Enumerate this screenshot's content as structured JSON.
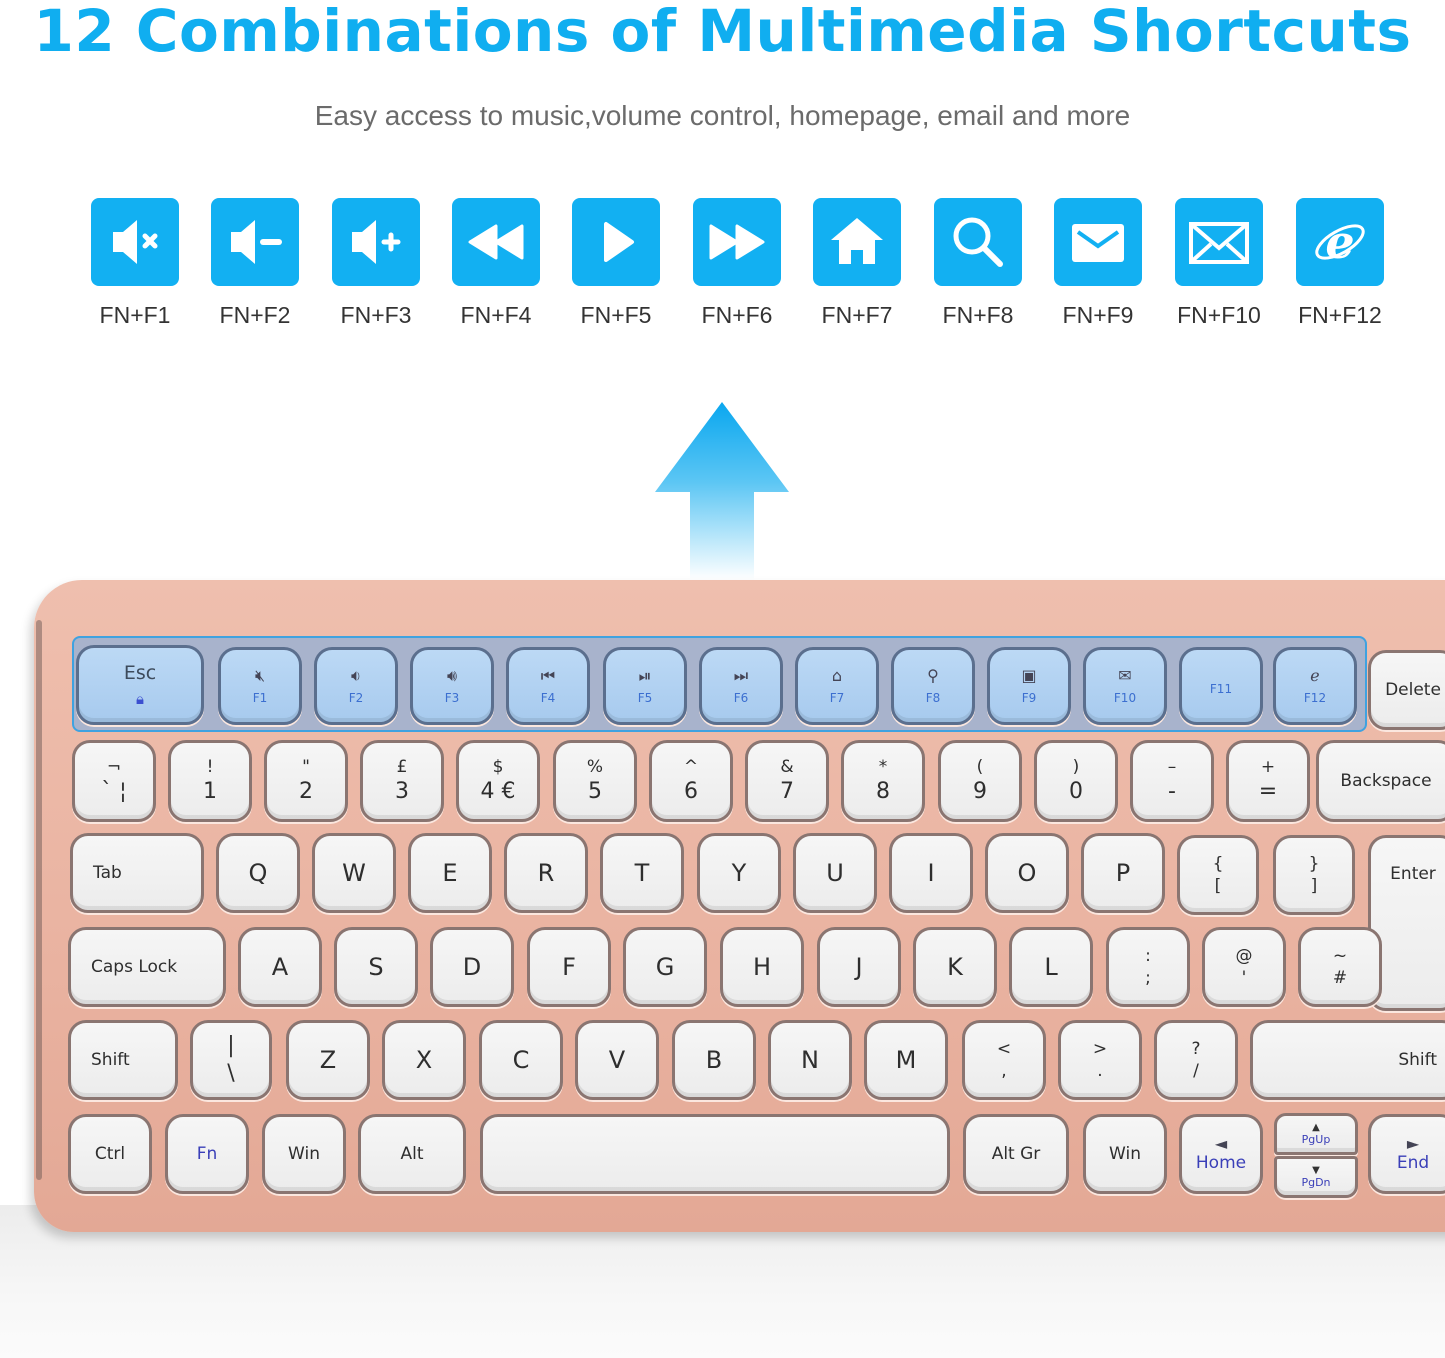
{
  "header": {
    "title": "12 Combinations of Multimedia Shortcuts",
    "subtitle": "Easy access to music,volume control, homepage, email and more"
  },
  "colors": {
    "accent": "#12b0f2",
    "keyboard_body": "#e9b2a0",
    "fn_highlight": "#a7caee",
    "fn_text_blue": "#3a3fb8"
  },
  "shortcuts": [
    {
      "icon": "mute-icon",
      "label": "FN+F1"
    },
    {
      "icon": "volume-down-icon",
      "label": "FN+F2"
    },
    {
      "icon": "volume-up-icon",
      "label": "FN+F3"
    },
    {
      "icon": "rewind-icon",
      "label": "FN+F4"
    },
    {
      "icon": "play-icon",
      "label": "FN+F5"
    },
    {
      "icon": "fast-forward-icon",
      "label": "FN+F6"
    },
    {
      "icon": "home-icon",
      "label": "FN+F7"
    },
    {
      "icon": "search-icon",
      "label": "FN+F8"
    },
    {
      "icon": "mail-icon",
      "label": "FN+F9"
    },
    {
      "icon": "envelope-icon",
      "label": "FN+F10"
    },
    {
      "icon": "browser-icon",
      "label": "FN+F12"
    }
  ],
  "keyboard": {
    "esc": {
      "label": "Esc",
      "sub_icon": "fn-lock-icon"
    },
    "fkeys": [
      {
        "icon": "mute-icon",
        "glyph": "🔇︎",
        "label": "F1"
      },
      {
        "icon": "volume-down-icon",
        "glyph": "🔉︎",
        "label": "F2"
      },
      {
        "icon": "volume-up-icon",
        "glyph": "🔊︎",
        "label": "F3"
      },
      {
        "icon": "previous-track-icon",
        "glyph": "⏮",
        "label": "F4"
      },
      {
        "icon": "play-pause-icon",
        "glyph": "⏯",
        "label": "F5"
      },
      {
        "icon": "next-track-icon",
        "glyph": "⏭",
        "label": "F6"
      },
      {
        "icon": "home-icon",
        "glyph": "⌂",
        "label": "F7"
      },
      {
        "icon": "search-icon",
        "glyph": "⚲",
        "label": "F8"
      },
      {
        "icon": "folder-star-icon",
        "glyph": "▣",
        "label": "F9"
      },
      {
        "icon": "mail-icon",
        "glyph": "✉",
        "label": "F10"
      },
      {
        "icon": "",
        "glyph": "",
        "label": "F11"
      },
      {
        "icon": "browser-icon",
        "glyph": "ℯ",
        "label": "F12"
      }
    ],
    "delete": "Delete",
    "number_row": [
      {
        "top": "¬",
        "bottom": "` ¦"
      },
      {
        "top": "!",
        "bottom": "1"
      },
      {
        "top": "\"",
        "bottom": "2"
      },
      {
        "top": "£",
        "bottom": "3"
      },
      {
        "top": "$",
        "bottom": "4 €"
      },
      {
        "top": "%",
        "bottom": "5"
      },
      {
        "top": "^",
        "bottom": "6"
      },
      {
        "top": "&",
        "bottom": "7"
      },
      {
        "top": "*",
        "bottom": "8"
      },
      {
        "top": "(",
        "bottom": "9"
      },
      {
        "top": ")",
        "bottom": "0"
      },
      {
        "top": "–",
        "bottom": "-"
      },
      {
        "top": "+",
        "bottom": "="
      }
    ],
    "backspace": "Backspace",
    "tab": "Tab",
    "qwerty_row": [
      "Q",
      "W",
      "E",
      "R",
      "T",
      "Y",
      "U",
      "I",
      "O",
      "P"
    ],
    "brackets": [
      {
        "top": "{",
        "bottom": "["
      },
      {
        "top": "}",
        "bottom": "]"
      }
    ],
    "enter": "Enter",
    "caps_lock": "Caps Lock",
    "home_row": [
      "A",
      "S",
      "D",
      "F",
      "G",
      "H",
      "J",
      "K",
      "L"
    ],
    "home_row_symbols": [
      {
        "top": ":",
        "bottom": ";"
      },
      {
        "top": "@",
        "bottom": "'"
      },
      {
        "top": "~",
        "bottom": "#"
      }
    ],
    "shift_left": "Shift",
    "backslash": {
      "top": "|",
      "bottom": "\\"
    },
    "bottom_letters": [
      "Z",
      "X",
      "C",
      "V",
      "B",
      "N",
      "M"
    ],
    "bottom_symbols": [
      {
        "top": "<",
        "bottom": ","
      },
      {
        "top": ">",
        "bottom": "."
      },
      {
        "top": "?",
        "bottom": "/"
      }
    ],
    "shift_right": "Shift",
    "ctrl": "Ctrl",
    "fn": "Fn",
    "win_left": "Win",
    "alt": "Alt",
    "alt_gr": "Alt Gr",
    "win_right": "Win",
    "home": {
      "arrow": "◄",
      "label": "Home"
    },
    "pgup": {
      "arrow": "▲",
      "label": "PgUp"
    },
    "pgdn": {
      "arrow": "▼",
      "label": "PgDn"
    },
    "end": {
      "arrow": "►",
      "label": "End"
    }
  }
}
